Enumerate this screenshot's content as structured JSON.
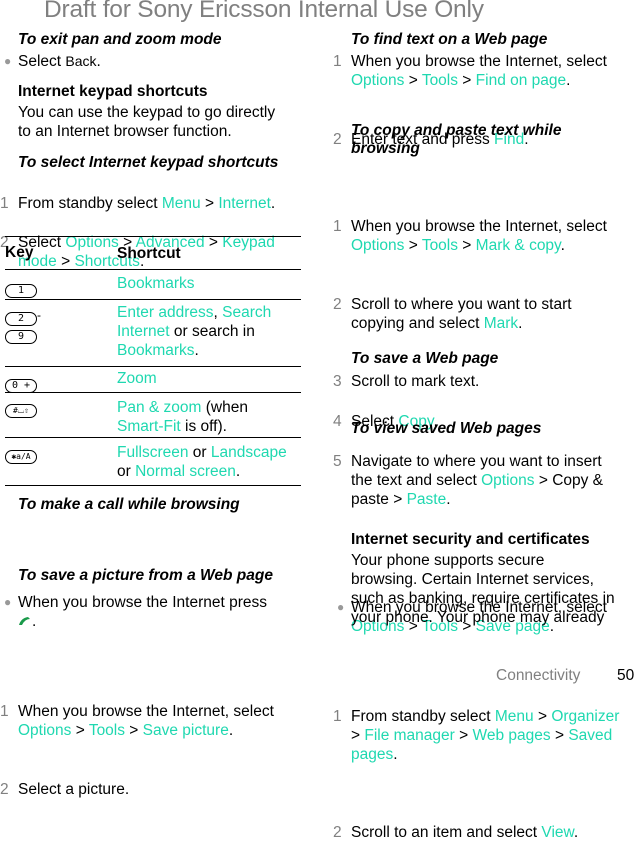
{
  "watermark": "Draft for Sony Ericsson Internal Use Only",
  "left": {
    "exit_pan": {
      "heading": "To exit pan and zoom mode",
      "bullet": {
        "pre": "Select ",
        "ui": "Back",
        "post": "."
      }
    },
    "keypad": {
      "heading": "Internet keypad shortcuts",
      "body_line1": "You can use the keypad to go directly",
      "body_line2": "to an Internet browser function."
    },
    "select_shortcuts": {
      "heading": "To select Internet keypad shortcuts",
      "step1": {
        "num": "1",
        "pre": "From standby select ",
        "l1": "Menu",
        "sep": " > ",
        "l2": "Internet",
        "post": "."
      },
      "step2": {
        "num": "2",
        "pre": "Select ",
        "l1": "Options",
        "sep1": " > ",
        "l2": "Advanced",
        "sep2": " > ",
        "l3a": "Keypad",
        "l3b": "mode",
        "sep3": " > ",
        "l4": "Shortcuts",
        "post": "."
      }
    },
    "table": {
      "header_key": "Key",
      "header_shortcut": "Shortcut",
      "rows": [
        {
          "keys": [
            "1"
          ],
          "icon": "key-1-icon",
          "shortcut_l1": "Bookmarks"
        },
        {
          "keys": [
            "2",
            "9"
          ],
          "range_sep": "-",
          "shortcut_l1a": "Enter address",
          "comma": ", ",
          "shortcut_l1b": "Search",
          "shortcut_l2a": "Internet",
          "shortcut_l2b": " or search in",
          "shortcut_l3": "Bookmarks",
          "post": "."
        },
        {
          "keys": [
            "0 +"
          ],
          "shortcut_l1": "Zoom"
        },
        {
          "keys": [
            "#⌴⇧"
          ],
          "shortcut_l1a": "Pan & zoom",
          "shortcut_l1b": " (when",
          "shortcut_l2a": "Smart-Fit",
          "shortcut_l2b": " is off)."
        },
        {
          "keys": [
            "✱a/A"
          ],
          "shortcut_l1a": "Fullscreen",
          "shortcut_l1b": " or ",
          "shortcut_l1c": "Landscape",
          "shortcut_l2a": "or ",
          "shortcut_l2b": "Normal screen",
          "post": "."
        }
      ]
    },
    "make_call": {
      "heading": "To make a call while browsing",
      "bullet": "When you browse the Internet press",
      "post": "."
    },
    "save_picture": {
      "heading": "To save a picture from a Web page",
      "step1": {
        "num": "1",
        "text": "When you browse the Internet, select",
        "l1": "Options",
        "sep": " > ",
        "l2": "Tools",
        "l3": "Save picture",
        "post": "."
      },
      "step2": {
        "num": "2",
        "text": "Select a picture."
      }
    }
  },
  "right": {
    "find_text": {
      "heading": "To find text on a Web page",
      "step1": {
        "num": "1",
        "text": "When you browse the Internet, select",
        "l1": "Options",
        "sep": " > ",
        "l2": "Tools",
        "l3": "Find on page",
        "post": "."
      },
      "step2": {
        "num": "2",
        "pre": "Enter text and press ",
        "l1": "Find",
        "post": "."
      }
    },
    "copy_paste": {
      "heading_l1": "To copy and paste text while",
      "heading_l2": "browsing",
      "step1": {
        "num": "1",
        "text": "When you browse the Internet, select",
        "l1": "Options",
        "sep": " > ",
        "l2": "Tools",
        "l3": "Mark & copy",
        "post": "."
      },
      "step2": {
        "num": "2",
        "text": "Scroll to where you want to start",
        "pre2": "copying and select ",
        "l1": "Mark",
        "post": "."
      },
      "step3": {
        "num": "3",
        "text": "Scroll to mark text."
      },
      "step4": {
        "num": "4",
        "pre": "Select ",
        "l1": "Copy",
        "post": "."
      },
      "step5": {
        "num": "5",
        "text": "Navigate to where you want to insert",
        "pre2": "the text and select ",
        "l1": "Options",
        "mid": " > Copy &",
        "pre3": "paste > ",
        "l2": "Paste",
        "post": "."
      }
    },
    "save_page": {
      "heading": "To save a Web page",
      "bullet": "When you browse the Internet, select",
      "l1": "Options",
      "sep": " > ",
      "l2": "Tools",
      "l3": "Save page",
      "post": "."
    },
    "view_saved": {
      "heading": "To view saved Web pages",
      "step1": {
        "num": "1",
        "pre": "From standby select ",
        "l1": "Menu",
        "sep": " > ",
        "l2": "Organizer",
        "pre2": "> ",
        "l3": "File manager",
        "l4": "Web pages",
        "l5": "Saved",
        "l6": "pages",
        "post": "."
      },
      "step2": {
        "num": "2",
        "pre": "Scroll to an item and select ",
        "l1": "View",
        "post": "."
      }
    },
    "security": {
      "heading": "Internet security and certificates",
      "lines": [
        "Your phone supports secure",
        "browsing. Certain Internet services,",
        "such as banking, require certificates in",
        "your phone. Your phone may already"
      ]
    }
  },
  "footer": {
    "section": "Connectivity",
    "page": "50"
  },
  "colors": {
    "link": "#1fd8b0",
    "watermark": "#808080",
    "step_number": "#808080"
  }
}
